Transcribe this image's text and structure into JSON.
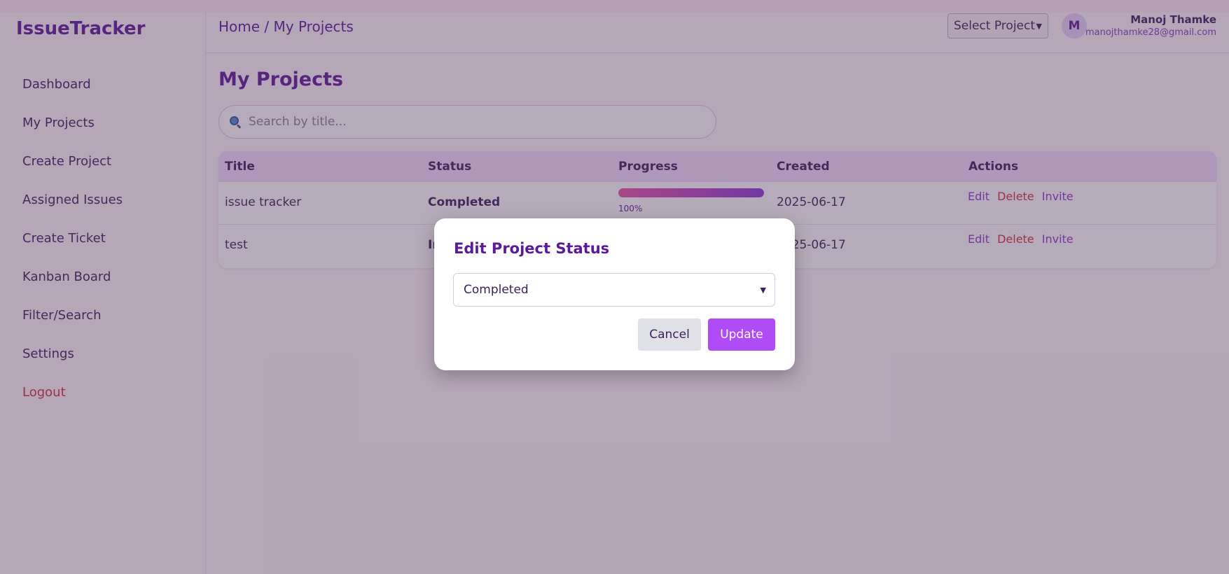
{
  "app": {
    "logo": "IssueTracker"
  },
  "sidebar": {
    "items": [
      {
        "label": "Dashboard"
      },
      {
        "label": "My Projects"
      },
      {
        "label": "Create Project"
      },
      {
        "label": "Assigned Issues"
      },
      {
        "label": "Create Ticket"
      },
      {
        "label": "Kanban Board"
      },
      {
        "label": "Filter/Search"
      },
      {
        "label": "Settings"
      },
      {
        "label": "Logout"
      }
    ]
  },
  "header": {
    "breadcrumb": "Home / My Projects",
    "project_select": "Select Project",
    "avatar_initial": "M",
    "user_name": "Manoj Thamke",
    "user_email": "manojthamke28@gmail.com"
  },
  "main": {
    "title": "My Projects",
    "search": {
      "placeholder": "Search by title..."
    },
    "table": {
      "columns": [
        "Title",
        "Status",
        "Progress",
        "Created",
        "Actions"
      ],
      "rows": [
        {
          "title": "issue tracker",
          "status": "Completed",
          "progress": 100,
          "progress_label": "100%",
          "created": "2025-06-17"
        },
        {
          "title": "test",
          "status": "In",
          "created": "2025-06-17"
        }
      ],
      "actions": {
        "edit": "Edit",
        "delete": "Delete",
        "invite": "Invite"
      }
    }
  },
  "modal": {
    "title": "Edit Project Status",
    "select_value": "Completed",
    "cancel_label": "Cancel",
    "update_label": "Update"
  },
  "colors": {
    "brand": "#5b1a99",
    "accent": "#b04cf5",
    "danger": "#d0313b",
    "progress_start": "#e754a8",
    "progress_end": "#8a3ad6"
  }
}
